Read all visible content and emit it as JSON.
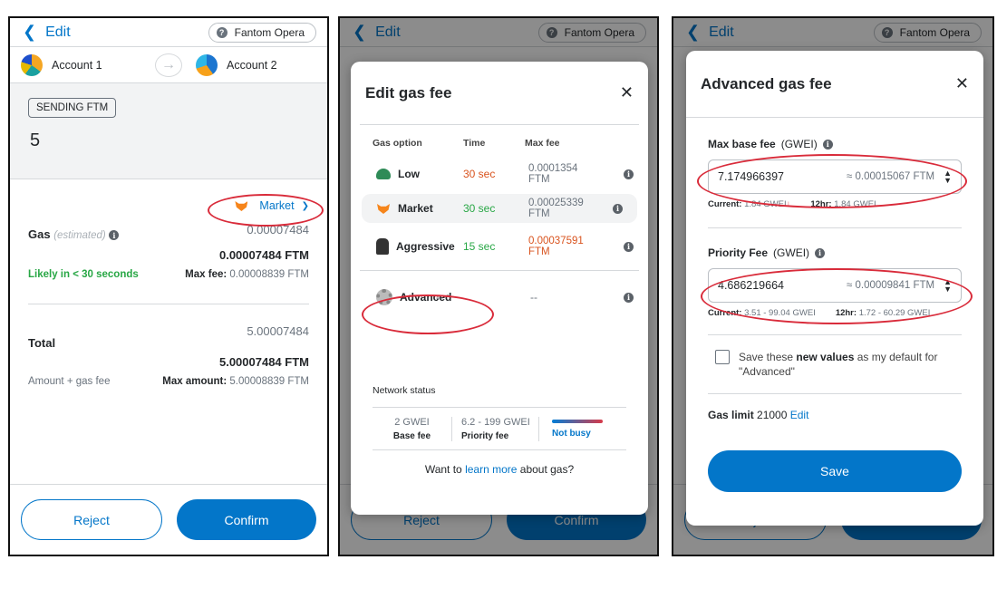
{
  "common": {
    "edit_label": "Edit",
    "back_glyph": "❮",
    "network": "Fantom Opera",
    "network_icon": "?",
    "info_glyph": "i",
    "reject": "Reject",
    "confirm": "Confirm"
  },
  "panel1": {
    "account_from": "Account 1",
    "account_to": "Account 2",
    "arrow": "→",
    "sending_tag": "SENDING FTM",
    "amount": "5",
    "market_label": "Market",
    "market_chevron": "❯",
    "gas_label": "Gas",
    "gas_estimated": "(estimated)",
    "gas_value": "0.00007484",
    "gas_value_ftm": "0.00007484 FTM",
    "likely": "Likely in < 30 seconds",
    "max_fee_label": "Max fee:",
    "max_fee_value": "0.00008839 FTM",
    "total_label": "Total",
    "total_value": "5.00007484",
    "total_value_ftm": "5.00007484 FTM",
    "amount_gas_label": "Amount + gas fee",
    "max_amount_label": "Max amount:",
    "max_amount_value": "5.00008839 FTM"
  },
  "panel2": {
    "title": "Edit gas fee",
    "close": "✕",
    "col_option": "Gas option",
    "col_time": "Time",
    "col_maxfee": "Max fee",
    "options": [
      {
        "label": "Low",
        "time": "30 sec",
        "fee": "0.0001354 FTM"
      },
      {
        "label": "Market",
        "time": "30 sec",
        "fee": "0.00025339 FTM"
      },
      {
        "label": "Aggressive",
        "time": "15 sec",
        "fee": "0.00037591 FTM"
      },
      {
        "label": "Advanced",
        "time": "--",
        "fee": "--"
      }
    ],
    "network_status": "Network status",
    "base_fee_value": "2 GWEI",
    "base_fee_label": "Base fee",
    "priority_fee_value": "6.2 - 199 GWEI",
    "priority_fee_label": "Priority fee",
    "busy_status": "Not busy",
    "learn_prefix": "Want to ",
    "learn_link": "learn more",
    "learn_suffix": " about gas?"
  },
  "panel3": {
    "title": "Advanced gas fee",
    "close": "✕",
    "max_base_label": "Max base fee",
    "max_base_unit": "(GWEI)",
    "max_base_value": "7.174966397",
    "max_base_ftm": "≈ 0.00015067 FTM",
    "current_label": "Current:",
    "current_value": "1.84 GWEI",
    "trend_glyph": "↓",
    "twelve_label": "12hr:",
    "twelve_value": "1.84 GWEI",
    "priority_label": "Priority Fee",
    "priority_unit": "(GWEI)",
    "priority_value": "4.686219664",
    "priority_ftm": "≈ 0.00009841 FTM",
    "p_current_value": "3.51 - 99.04 GWEI",
    "p_twelve_value": "1.72 - 60.29 GWEI",
    "save_default_prefix": "Save these ",
    "save_default_bold": "new values",
    "save_default_suffix": " as my default for \"Advanced\"",
    "gas_limit_label": "Gas limit",
    "gas_limit_value": "21000",
    "gas_limit_edit": "Edit",
    "save_button": "Save",
    "stepper_up": "▲",
    "stepper_down": "▼"
  },
  "colors": {
    "accent": "#0376c9",
    "annotation": "#d92b3a",
    "orange": "#d9531e",
    "green": "#28a745"
  }
}
